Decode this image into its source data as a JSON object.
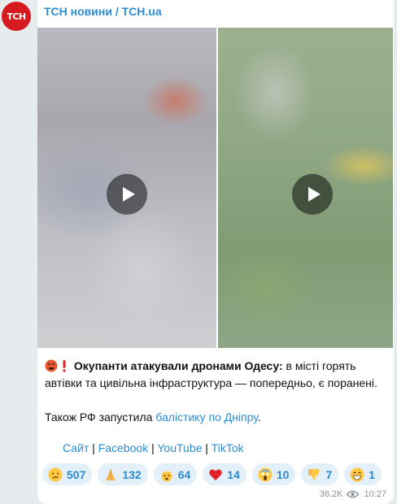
{
  "channel": {
    "avatar_text": "ТСН",
    "name": "ТСН новини / TCH.ua"
  },
  "post": {
    "headline_bold": "Окупанти атакували дронами Одесу:",
    "headline_rest": " в місті горять автівки та цивільна інфраструктура — попередньо, є поранені.",
    "second_prefix": "Також РФ запустила ",
    "second_link": "балістику по Дніпру",
    "second_suffix": ".",
    "links": {
      "site": "Сайт",
      "facebook": "Facebook",
      "youtube": "YouTube",
      "tiktok": "TikTok",
      "separator": " | "
    }
  },
  "reactions": [
    {
      "icon": "crying-face-icon",
      "count": "507"
    },
    {
      "icon": "folded-hands-icon",
      "count": "132"
    },
    {
      "icon": "exploding-head-icon",
      "count": "64"
    },
    {
      "icon": "red-heart-icon",
      "count": "14"
    },
    {
      "icon": "screaming-face-icon",
      "count": "10"
    },
    {
      "icon": "thumbs-down-icon",
      "count": "7"
    },
    {
      "icon": "grinning-face-icon",
      "count": "1"
    }
  ],
  "meta": {
    "views": "36.2K",
    "time": "10:27"
  },
  "colors": {
    "accent": "#2d8cd0",
    "avatar_bg": "#d71920",
    "reaction_bg": "#e3eff9",
    "chat_bg": "#e6ebee"
  }
}
